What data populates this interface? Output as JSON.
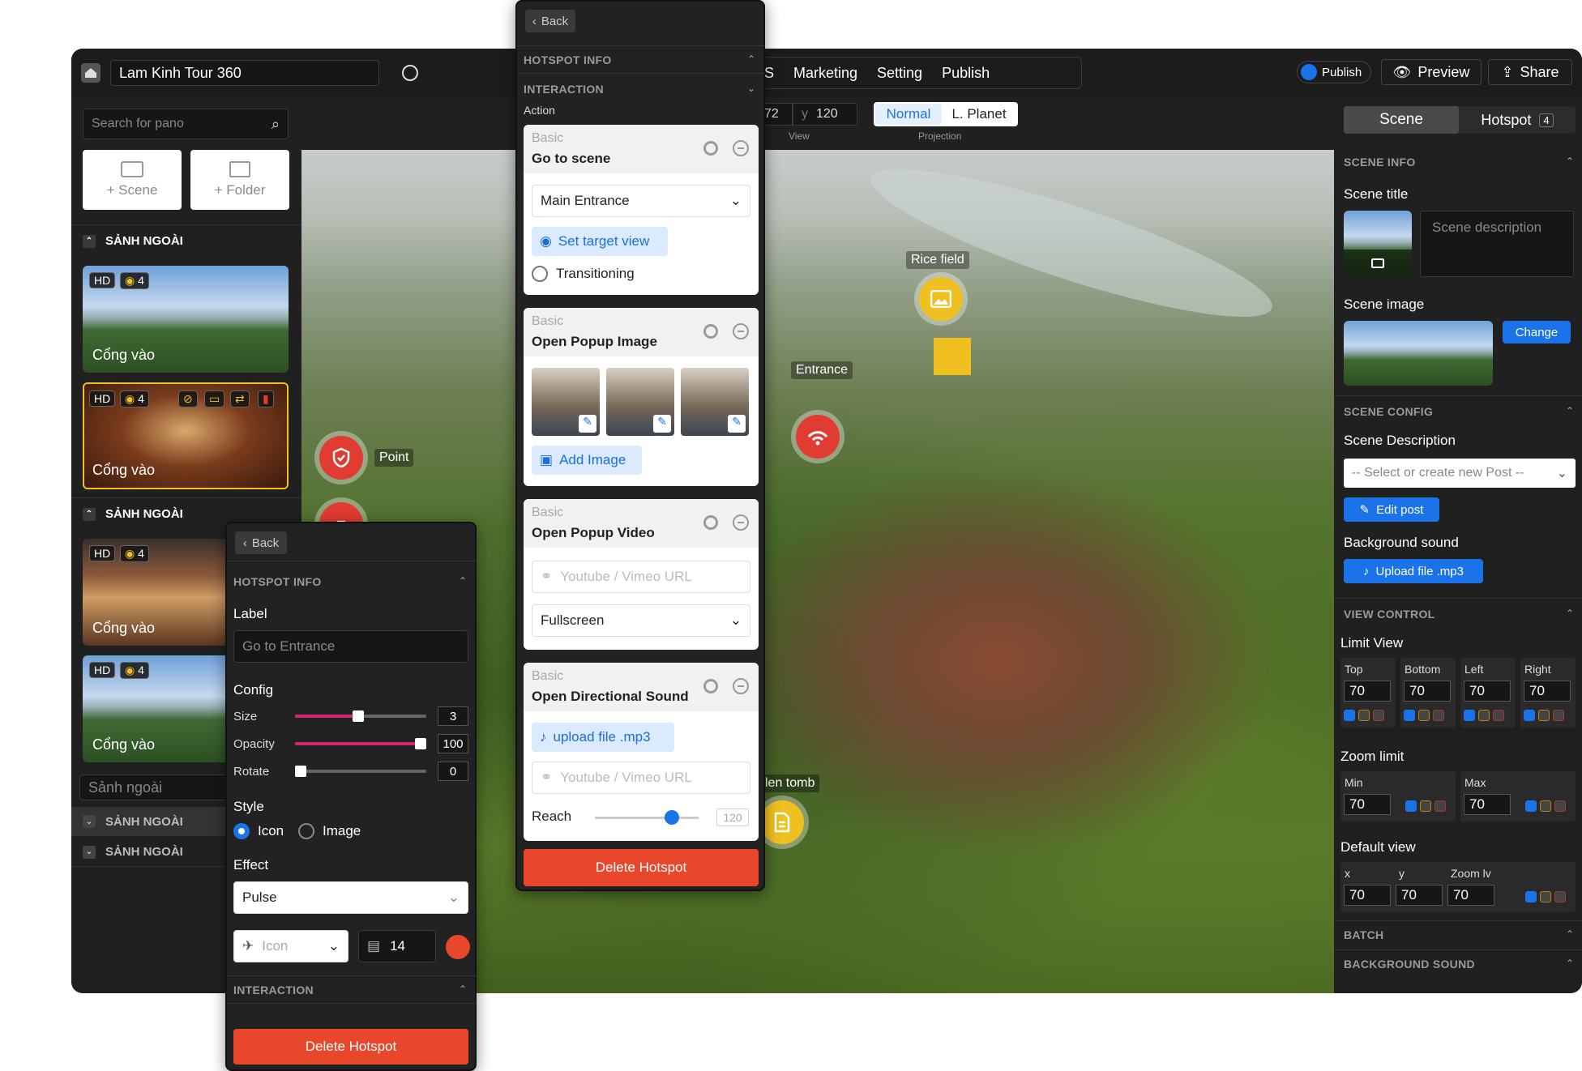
{
  "topbar": {
    "project_title": "Lam Kinh Tour 360",
    "menu": [
      "MS",
      "Marketing",
      "Setting",
      "Publish"
    ],
    "publish_toggle_label": "Publish",
    "preview_label": "Preview",
    "share_label": "Share"
  },
  "viewbar": {
    "x_value": "72",
    "y_prefix": "y",
    "y_value": "120",
    "view_caption": "View",
    "projection_options": [
      "Normal",
      "L. Planet"
    ],
    "projection_selected": "Normal",
    "projection_caption": "Projection"
  },
  "sidebar": {
    "search_placeholder": "Search for pano",
    "add_scene_label": "+ Scene",
    "add_folder_label": "+ Folder",
    "group1_title": "SẢNH NGOÀI",
    "group2_title": "SẢNH NGOÀI",
    "rename_value": "Sảnh ngoài",
    "group3_title": "SẢNH NGOÀI",
    "group4_title": "SẢNH NGOÀI",
    "scenes": [
      {
        "hd": "HD",
        "count": "4",
        "name": "Cổng vào"
      },
      {
        "hd": "HD",
        "count": "4",
        "name": "Cổng vào"
      },
      {
        "hd": "HD",
        "count": "4",
        "name": "Cổng vào"
      },
      {
        "hd": "HD",
        "count": "4",
        "name": "Cổng vào"
      }
    ]
  },
  "hotspots": {
    "rice_field": "Rice field",
    "entrance": "Entrance",
    "point": "Point",
    "tomb": "len tomb"
  },
  "right_panel": {
    "tabs": [
      "Scene",
      "Hotspot"
    ],
    "hotspot_count": "4",
    "scene_info_title": "SCENE INFO",
    "scene_title_label": "Scene title",
    "scene_description_placeholder": "Scene description",
    "scene_image_label": "Scene image",
    "change_label": "Change",
    "scene_config_title": "SCENE CONFIG",
    "scene_description_label": "Scene Description",
    "post_select_placeholder": "-- Select or create new Post --",
    "edit_post_label": "Edit post",
    "background_sound_label": "Background sound",
    "upload_label": "Upload file .mp3",
    "view_control_title": "VIEW CONTROL",
    "limit_view_label": "Limit View",
    "limits": [
      {
        "name": "Top",
        "value": "70"
      },
      {
        "name": "Bottom",
        "value": "70"
      },
      {
        "name": "Left",
        "value": "70"
      },
      {
        "name": "Right",
        "value": "70"
      }
    ],
    "zoom_limit_label": "Zoom limit",
    "zoom": [
      {
        "name": "Min",
        "value": "70"
      },
      {
        "name": "Max",
        "value": "70"
      }
    ],
    "default_view_label": "Default view",
    "default_view": [
      {
        "name": "x",
        "value": "70"
      },
      {
        "name": "y",
        "value": "70"
      },
      {
        "name": "Zoom lv",
        "value": "70"
      }
    ],
    "batch_title": "BATCH",
    "bg_sound_title": "BACKGROUND SOUND"
  },
  "interaction_panel": {
    "back_label": "Back",
    "hotspot_info_title": "HOTSPOT INFO",
    "interaction_title": "INTERACTION",
    "action_label": "Action",
    "card1": {
      "kind": "Basic",
      "title": "Go to scene",
      "select": "Main Entrance",
      "target_view": "Set target view",
      "transitioning": "Transitioning"
    },
    "card2": {
      "kind": "Basic",
      "title": "Open Popup Image",
      "add_image": "Add Image"
    },
    "card3": {
      "kind": "Basic",
      "title": "Open Popup Video",
      "url_placeholder": "Youtube / Vimeo URL",
      "mode": "Fullscreen"
    },
    "card4": {
      "kind": "Basic",
      "title": "Open Directional Sound",
      "upload": "upload file .mp3",
      "url_placeholder": "Youtube / Vimeo URL",
      "reach_label": "Reach",
      "reach_value": "120",
      "reach_fraction": 0.74
    },
    "delete_label": "Delete Hotspot"
  },
  "hotspot_panel": {
    "back_label": "Back",
    "hotspot_info_title": "HOTSPOT INFO",
    "label_label": "Label",
    "label_placeholder": "Go to Entrance",
    "config_label": "Config",
    "size_label": "Size",
    "size_value": "3",
    "size_fraction": 0.48,
    "opacity_label": "Opacity",
    "opacity_value": "100",
    "opacity_fraction": 1.0,
    "rotate_label": "Rotate",
    "rotate_value": "0",
    "rotate_fraction": 0.0,
    "style_label": "Style",
    "style_options": [
      "Icon",
      "Image"
    ],
    "style_selected": "Icon",
    "effect_label": "Effect",
    "effect_value": "Pulse",
    "icon_select_placeholder": "Icon",
    "icon_size_value": "14",
    "icon_color": "#e8472b",
    "interaction_title": "INTERACTION",
    "delete_label": "Delete Hotspot"
  },
  "colors": {
    "accent": "#1a73e8",
    "danger": "#e8472b",
    "hotspot_yellow": "#f0c020",
    "hotspot_red": "#e03c31"
  }
}
